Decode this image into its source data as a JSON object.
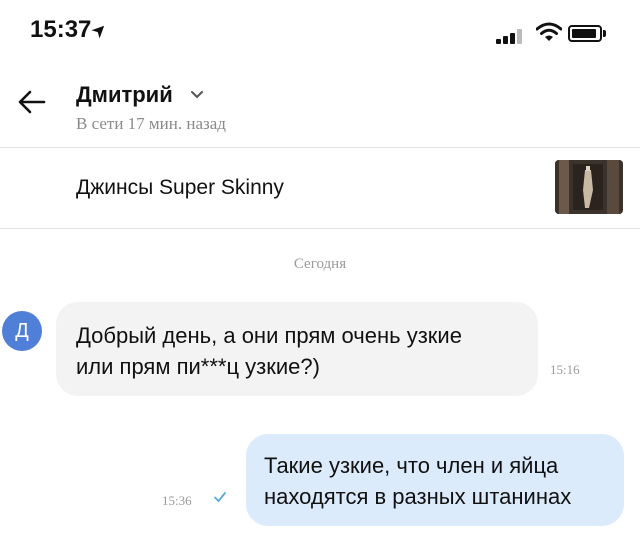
{
  "status_bar": {
    "time": "15:37",
    "location_icon": "location-arrow-icon",
    "signal_icon": "cellular-signal-icon",
    "wifi_icon": "wifi-icon",
    "battery_icon": "battery-icon"
  },
  "header": {
    "back_icon": "back-arrow-icon",
    "name": "Дмитрий",
    "chevron_icon": "chevron-down-icon",
    "status": "В сети 17 мин. назад"
  },
  "product": {
    "title": "Джинсы Super Skinny",
    "thumbnail_icon": "product-thumbnail"
  },
  "chat": {
    "date_label": "Сегодня",
    "messages": [
      {
        "direction": "incoming",
        "avatar_letter": "Д",
        "text": "Добрый день, а они прям очень узкие\nили прям пи***ц узкие?)",
        "time": "15:16"
      },
      {
        "direction": "outgoing",
        "text": "Такие узкие, что член и яйца\nнаходятся в разных штанинах",
        "time": "15:36",
        "read_icon": "checkmark-icon"
      }
    ]
  },
  "colors": {
    "accent": "#4f7fd6",
    "incoming_bubble": "#f3f3f3",
    "outgoing_bubble": "#dcebfb",
    "muted_text": "#9a9a9a",
    "check": "#5aa9d8"
  }
}
